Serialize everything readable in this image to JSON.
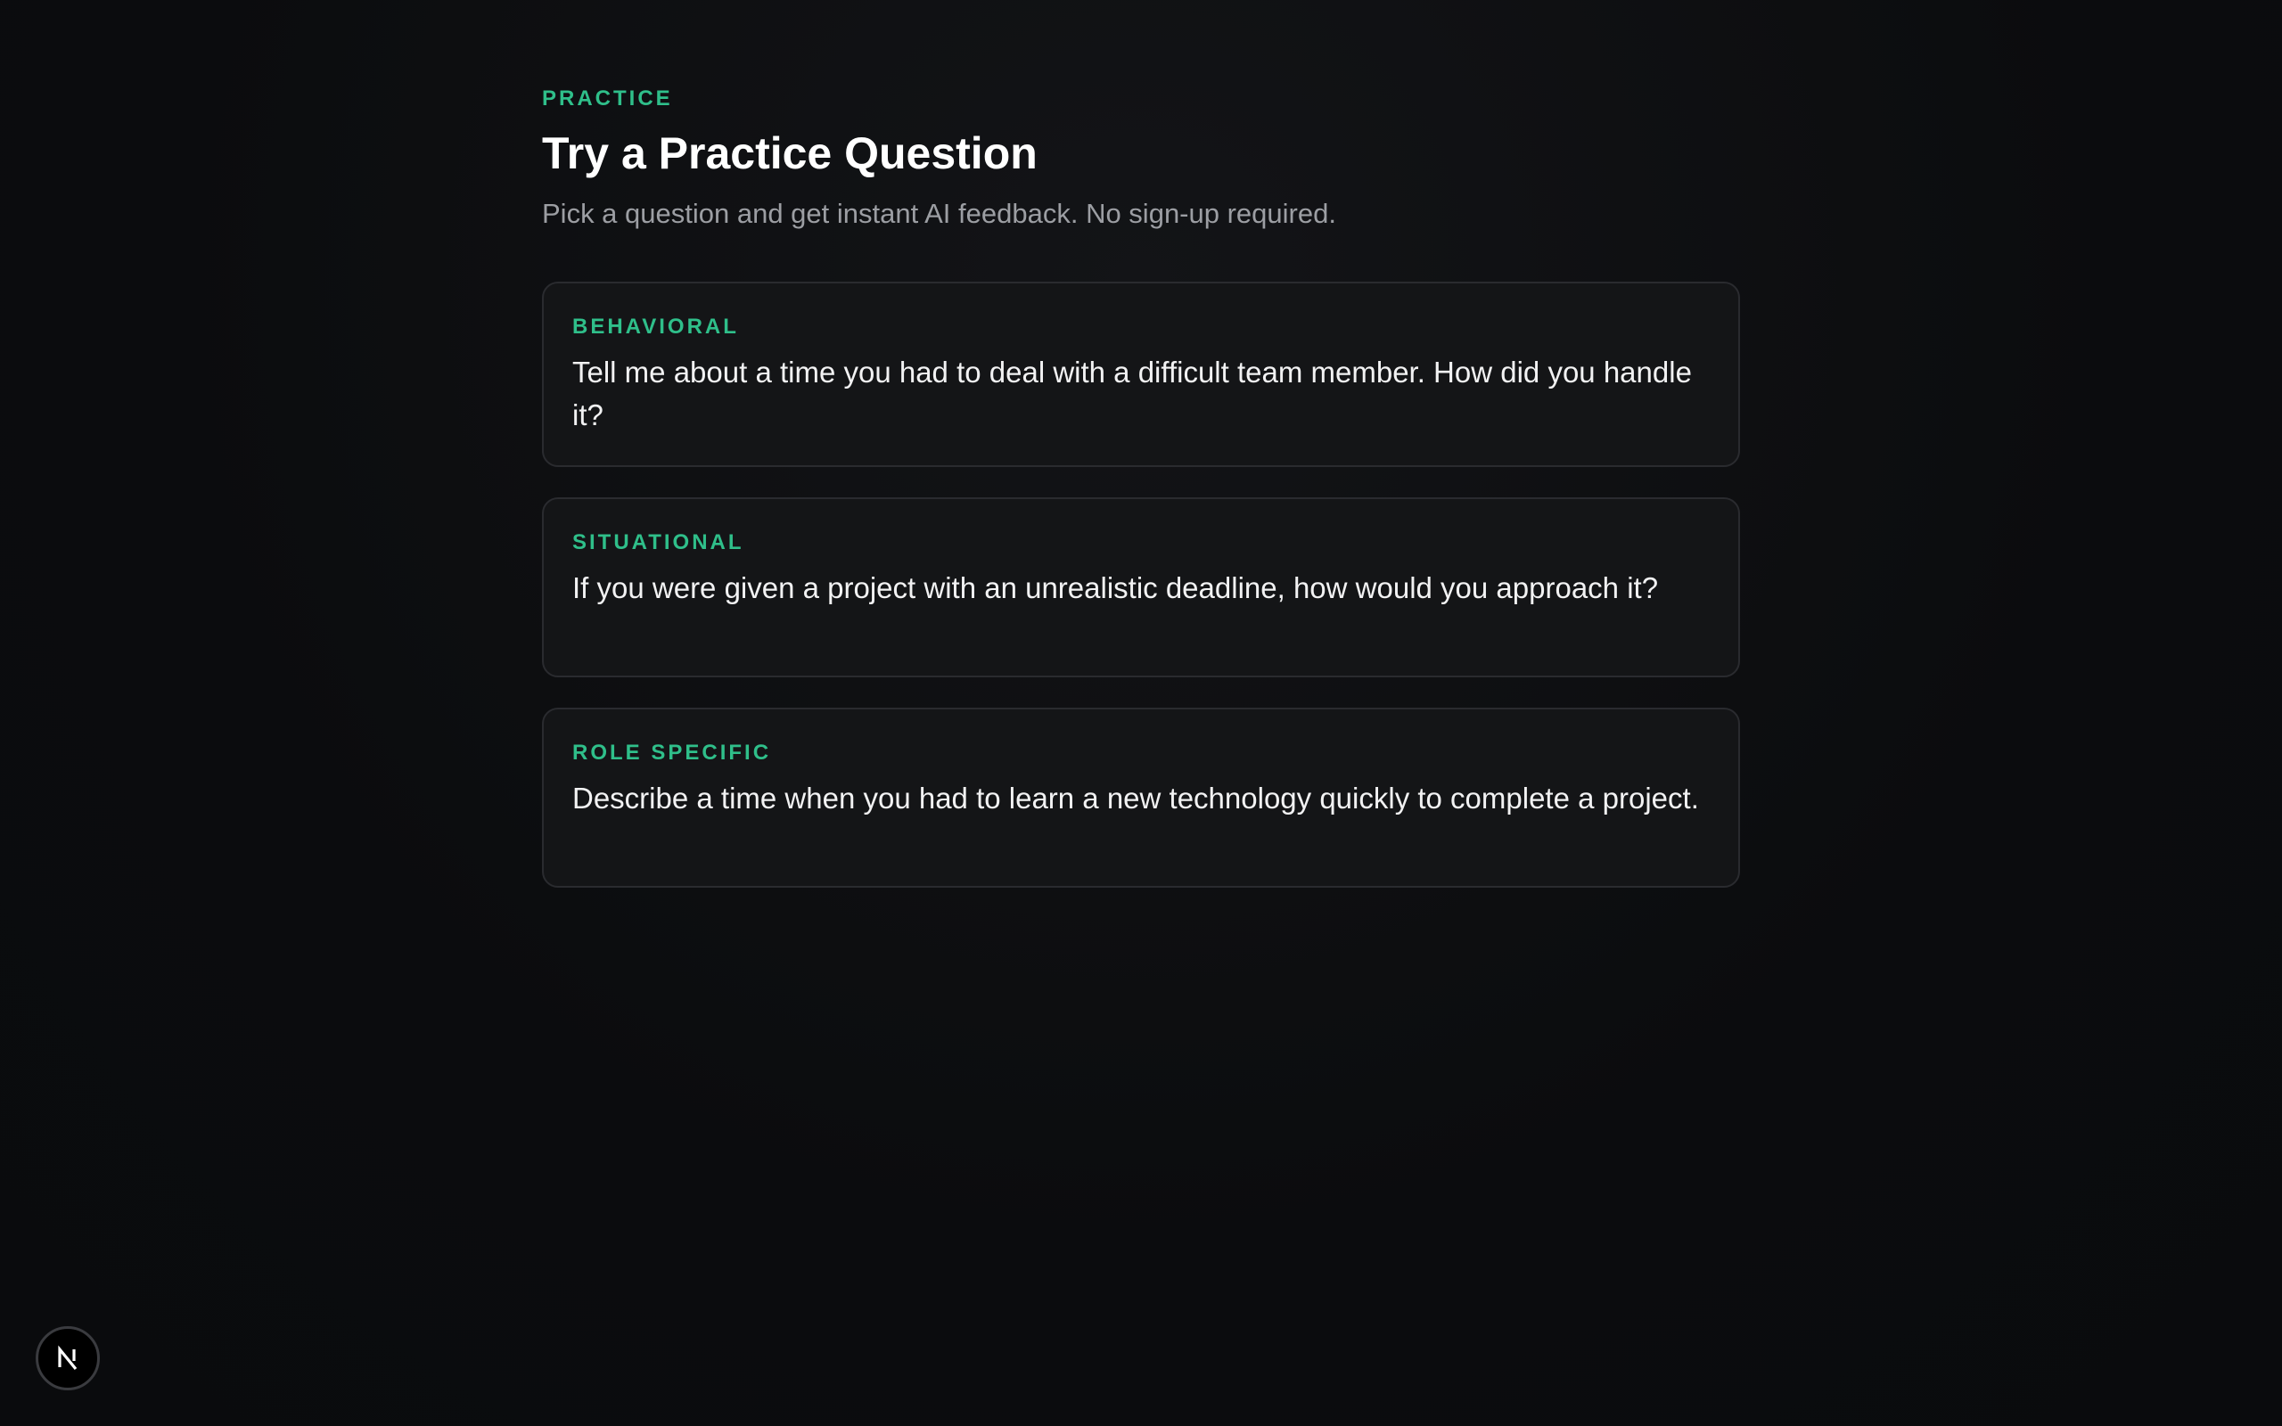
{
  "section": {
    "eyebrow": "PRACTICE",
    "title": "Try a Practice Question",
    "subtitle": "Pick a question and get instant AI feedback. No sign-up required."
  },
  "questions": [
    {
      "category": "BEHAVIORAL",
      "text": "Tell me about a time you had to deal with a difficult team member. How did you handle it?"
    },
    {
      "category": "SITUATIONAL",
      "text": "If you were given a project with an unrealistic deadline, how would you approach it?"
    },
    {
      "category": "ROLE SPECIFIC",
      "text": "Describe a time when you had to learn a new technology quickly to complete a project."
    }
  ],
  "badge": {
    "icon": "nextjs-logo-icon"
  },
  "colors": {
    "accent": "#2fbf8a",
    "background": "#0b0c0e",
    "card_background": "#141517",
    "card_border": "#2a2b2f",
    "subtitle": "#9c9ea3"
  }
}
